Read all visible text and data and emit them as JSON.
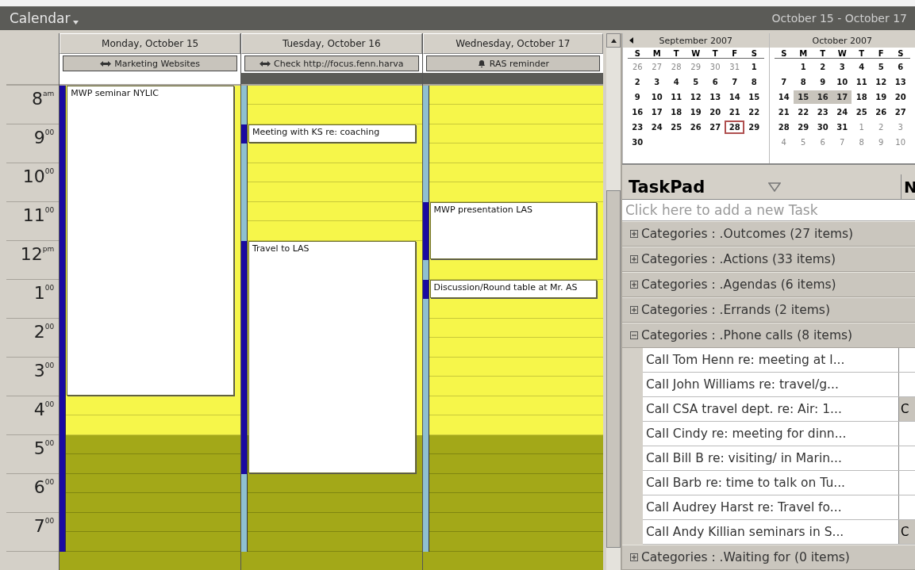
{
  "title": "Calendar",
  "date_range": "October 15 - October 17",
  "calendar": {
    "hours": [
      {
        "label": "8$^{am}$",
        "work": true
      },
      {
        "label": "9$^{00}$",
        "work": true
      },
      {
        "label": "10$^{00}$",
        "work": true
      },
      {
        "label": "11$^{00}$",
        "work": true
      },
      {
        "label": "12$^{pm}$",
        "work": true
      },
      {
        "label": "1$^{00}$",
        "work": true
      },
      {
        "label": "2$^{00}$",
        "work": true
      },
      {
        "label": "3$^{00}$",
        "work": true
      },
      {
        "label": "4$^{00}$",
        "work": true
      },
      {
        "label": "5$^{00}$",
        "work": false
      },
      {
        "label": "6$^{00}$",
        "work": false
      },
      {
        "label": "7$^{00}$",
        "work": false
      }
    ],
    "days": [
      {
        "label": "Monday, October 15",
        "all_day": {
          "text": "Marketing Websites",
          "kind": "multi-day"
        },
        "band_busy": false,
        "slots": [
          {
            "kind": "event",
            "title": "MWP seminar NYLIC",
            "busy": true
          },
          {
            "kind": "continue",
            "busy": true
          },
          {
            "kind": "continue",
            "busy": true
          },
          {
            "kind": "continue",
            "busy": true
          },
          {
            "kind": "continue",
            "busy": true
          },
          {
            "kind": "continue",
            "busy": true
          },
          {
            "kind": "continue",
            "busy": true
          },
          {
            "kind": "continue",
            "busy": true
          },
          {
            "kind": "continue",
            "busy": true
          },
          {
            "kind": "continue",
            "busy": true
          },
          {
            "kind": "continue",
            "busy": true
          },
          {
            "kind": "continue",
            "busy": true
          },
          {
            "kind": "continue",
            "busy": true
          },
          {
            "kind": "continue",
            "busy": true
          },
          {
            "kind": "continue",
            "busy": true
          },
          {
            "kind": "continue",
            "busy": true
          },
          {
            "kind": "free",
            "busy": true
          },
          {
            "kind": "free",
            "busy": true
          },
          {
            "kind": "free",
            "busy": true
          },
          {
            "kind": "free",
            "busy": true
          },
          {
            "kind": "free",
            "busy": true
          },
          {
            "kind": "free",
            "busy": true
          },
          {
            "kind": "free",
            "busy": true
          },
          {
            "kind": "free",
            "busy": true
          }
        ]
      },
      {
        "label": "Tuesday, October 16",
        "all_day": {
          "text": "Check http://focus.fenn.harva",
          "kind": "multi-day"
        },
        "band_busy": true,
        "slots": [
          {
            "kind": "free",
            "busy": false
          },
          {
            "kind": "free",
            "busy": false
          },
          {
            "kind": "event",
            "title": "Meeting with KS re: coaching",
            "busy": true
          },
          {
            "kind": "free",
            "busy": false
          },
          {
            "kind": "free",
            "busy": false
          },
          {
            "kind": "free",
            "busy": false
          },
          {
            "kind": "free",
            "busy": false
          },
          {
            "kind": "free",
            "busy": false
          },
          {
            "kind": "event",
            "title": "Travel to LAS",
            "busy": true
          },
          {
            "kind": "continue",
            "busy": true
          },
          {
            "kind": "continue",
            "busy": true
          },
          {
            "kind": "continue",
            "busy": true
          },
          {
            "kind": "continue",
            "busy": true
          },
          {
            "kind": "continue",
            "busy": true
          },
          {
            "kind": "continue",
            "busy": true
          },
          {
            "kind": "continue",
            "busy": true
          },
          {
            "kind": "continue",
            "busy": true
          },
          {
            "kind": "continue",
            "busy": true
          },
          {
            "kind": "continue",
            "busy": true
          },
          {
            "kind": "continue",
            "busy": true
          },
          {
            "kind": "free",
            "busy": false
          },
          {
            "kind": "free",
            "busy": false
          },
          {
            "kind": "free",
            "busy": false
          },
          {
            "kind": "free",
            "busy": false
          }
        ]
      },
      {
        "label": "Wednesday, October 17",
        "all_day": {
          "text": "RAS reminder",
          "kind": "reminder"
        },
        "band_busy": true,
        "slots": [
          {
            "kind": "free",
            "busy": false
          },
          {
            "kind": "free",
            "busy": false
          },
          {
            "kind": "free",
            "busy": false
          },
          {
            "kind": "free",
            "busy": false
          },
          {
            "kind": "free",
            "busy": false
          },
          {
            "kind": "free",
            "busy": false
          },
          {
            "kind": "event",
            "title": "MWP presentation LAS",
            "busy": true
          },
          {
            "kind": "continue",
            "busy": true
          },
          {
            "kind": "continue",
            "busy": true
          },
          {
            "kind": "free",
            "busy": false
          },
          {
            "kind": "event",
            "title": "Discussion/Round table at Mr. AS",
            "busy": true
          },
          {
            "kind": "free",
            "busy": false
          },
          {
            "kind": "free",
            "busy": false
          },
          {
            "kind": "free",
            "busy": false
          },
          {
            "kind": "free",
            "busy": false
          },
          {
            "kind": "free",
            "busy": false
          },
          {
            "kind": "free",
            "busy": false
          },
          {
            "kind": "free",
            "busy": false
          },
          {
            "kind": "free",
            "busy": false
          },
          {
            "kind": "free",
            "busy": false
          },
          {
            "kind": "free",
            "busy": false
          },
          {
            "kind": "free",
            "busy": false
          },
          {
            "kind": "free",
            "busy": false
          },
          {
            "kind": "free",
            "busy": false
          }
        ]
      }
    ]
  },
  "mini_calendar": {
    "months": [
      {
        "title": "September 2007",
        "weekdays": [
          "S",
          "M",
          "T",
          "W",
          "T",
          "F",
          "S"
        ],
        "weeks": [
          [
            {
              "d": "26",
              "out": true,
              "selected": false
            },
            {
              "d": "27",
              "out": true,
              "selected": false
            },
            {
              "d": "28",
              "out": true,
              "selected": false
            },
            {
              "d": "29",
              "out": true,
              "selected": false
            },
            {
              "d": "30",
              "out": true,
              "selected": false
            },
            {
              "d": "31",
              "out": true,
              "selected": false
            },
            {
              "d": "1",
              "out": false,
              "selected": false
            }
          ],
          [
            {
              "d": "2",
              "selected": false
            },
            {
              "d": "3",
              "selected": false
            },
            {
              "d": "4",
              "selected": false
            },
            {
              "d": "5",
              "selected": false
            },
            {
              "d": "6",
              "selected": false
            },
            {
              "d": "7",
              "selected": false
            },
            {
              "d": "8",
              "selected": false
            }
          ],
          [
            {
              "d": "9",
              "selected": false
            },
            {
              "d": "10",
              "selected": false
            },
            {
              "d": "11",
              "selected": false
            },
            {
              "d": "12",
              "selected": false
            },
            {
              "d": "13",
              "selected": false
            },
            {
              "d": "14",
              "selected": false
            },
            {
              "d": "15",
              "selected": false
            }
          ],
          [
            {
              "d": "16",
              "selected": false
            },
            {
              "d": "17",
              "selected": false
            },
            {
              "d": "18",
              "selected": false
            },
            {
              "d": "19",
              "selected": false
            },
            {
              "d": "20",
              "selected": false
            },
            {
              "d": "21",
              "selected": false
            },
            {
              "d": "22",
              "selected": false
            }
          ],
          [
            {
              "d": "23",
              "selected": false
            },
            {
              "d": "24",
              "selected": false
            },
            {
              "d": "25",
              "selected": false
            },
            {
              "d": "26",
              "selected": false
            },
            {
              "d": "27",
              "selected": false
            },
            {
              "d": "28",
              "selected": false,
              "today": true
            },
            {
              "d": "29",
              "selected": false
            }
          ],
          [
            {
              "d": "30",
              "selected": false
            }
          ]
        ]
      },
      {
        "title": "October 2007",
        "weekdays": [
          "S",
          "M",
          "T",
          "W",
          "T",
          "F",
          "S"
        ],
        "weeks": [
          [
            {
              "d": "1",
              "selected": false
            },
            {
              "d": "2",
              "selected": false
            },
            {
              "d": "3",
              "selected": false
            },
            {
              "d": "4",
              "selected": false
            },
            {
              "d": "5",
              "selected": false
            },
            {
              "d": "6",
              "selected": false
            }
          ],
          [
            {
              "d": "7",
              "selected": false
            },
            {
              "d": "8",
              "selected": false
            },
            {
              "d": "9",
              "selected": false
            },
            {
              "d": "10",
              "selected": false
            },
            {
              "d": "11",
              "selected": false
            },
            {
              "d": "12",
              "selected": false
            },
            {
              "d": "13",
              "selected": false
            }
          ],
          [
            {
              "d": "14",
              "selected": false
            },
            {
              "d": "15",
              "selected": true
            },
            {
              "d": "16",
              "selected": true
            },
            {
              "d": "17",
              "selected": true
            },
            {
              "d": "18",
              "selected": false
            },
            {
              "d": "19",
              "selected": false
            },
            {
              "d": "20",
              "selected": false
            }
          ],
          [
            {
              "d": "21",
              "selected": false
            },
            {
              "d": "22",
              "selected": false
            },
            {
              "d": "23",
              "selected": false
            },
            {
              "d": "24",
              "selected": false
            },
            {
              "d": "25",
              "selected": false
            },
            {
              "d": "26",
              "selected": false
            },
            {
              "d": "27",
              "selected": false
            }
          ],
          [
            {
              "d": "28",
              "out": false,
              "selected": false
            },
            {
              "d": "29",
              "out": false,
              "selected": false
            },
            {
              "d": "30",
              "out": false,
              "selected": false
            },
            {
              "d": "31",
              "out": false,
              "selected": false
            },
            {
              "d": "1",
              "out": true,
              "selected": false
            },
            {
              "d": "2",
              "out": true,
              "selected": false
            },
            {
              "d": "3",
              "out": true,
              "selected": false
            }
          ],
          [
            {
              "d": "4",
              "out": true,
              "selected": false
            },
            {
              "d": "5",
              "out": true,
              "selected": false
            },
            {
              "d": "6",
              "out": true,
              "selected": false
            },
            {
              "d": "7",
              "out": true,
              "selected": false
            },
            {
              "d": "8",
              "out": true,
              "selected": false
            },
            {
              "d": "9",
              "out": true,
              "selected": false
            },
            {
              "d": "10",
              "out": true,
              "selected": false
            }
          ]
        ]
      }
    ]
  },
  "taskpad": {
    "title": "TaskPad",
    "column_2": "N",
    "placeholder": "Click here to add a new Task",
    "groups": [
      {
        "label": "Categories : .Outcomes (27 items)",
        "expanded": false
      },
      {
        "label": "Categories : .Actions (33 items)",
        "expanded": false
      },
      {
        "label": "Categories : .Agendas (6 items)",
        "expanded": false
      },
      {
        "label": "Categories : .Errands (2 items)",
        "expanded": false
      },
      {
        "label": "Categories : .Phone calls (8 items)",
        "expanded": true,
        "tasks": [
          {
            "subject": "Call Tom Henn re: meeting at l..."
          },
          {
            "subject": "Call John Williams re: travel/g..."
          },
          {
            "subject": "Call CSA travel dept. re: Air: 1...",
            "column_2": "C"
          },
          {
            "subject": "Call Cindy re: meeting for dinn..."
          },
          {
            "subject": "Call Bill B re:  visiting/ in Marin..."
          },
          {
            "subject": "Call Barb re: time to talk on Tu..."
          },
          {
            "subject": "Call Audrey Harst re: Travel fo..."
          },
          {
            "subject": "Call Andy Killian seminars in S...",
            "column_2": "C"
          }
        ]
      },
      {
        "label": "Categories : .Waiting for (0 items)",
        "expanded": false
      }
    ]
  }
}
